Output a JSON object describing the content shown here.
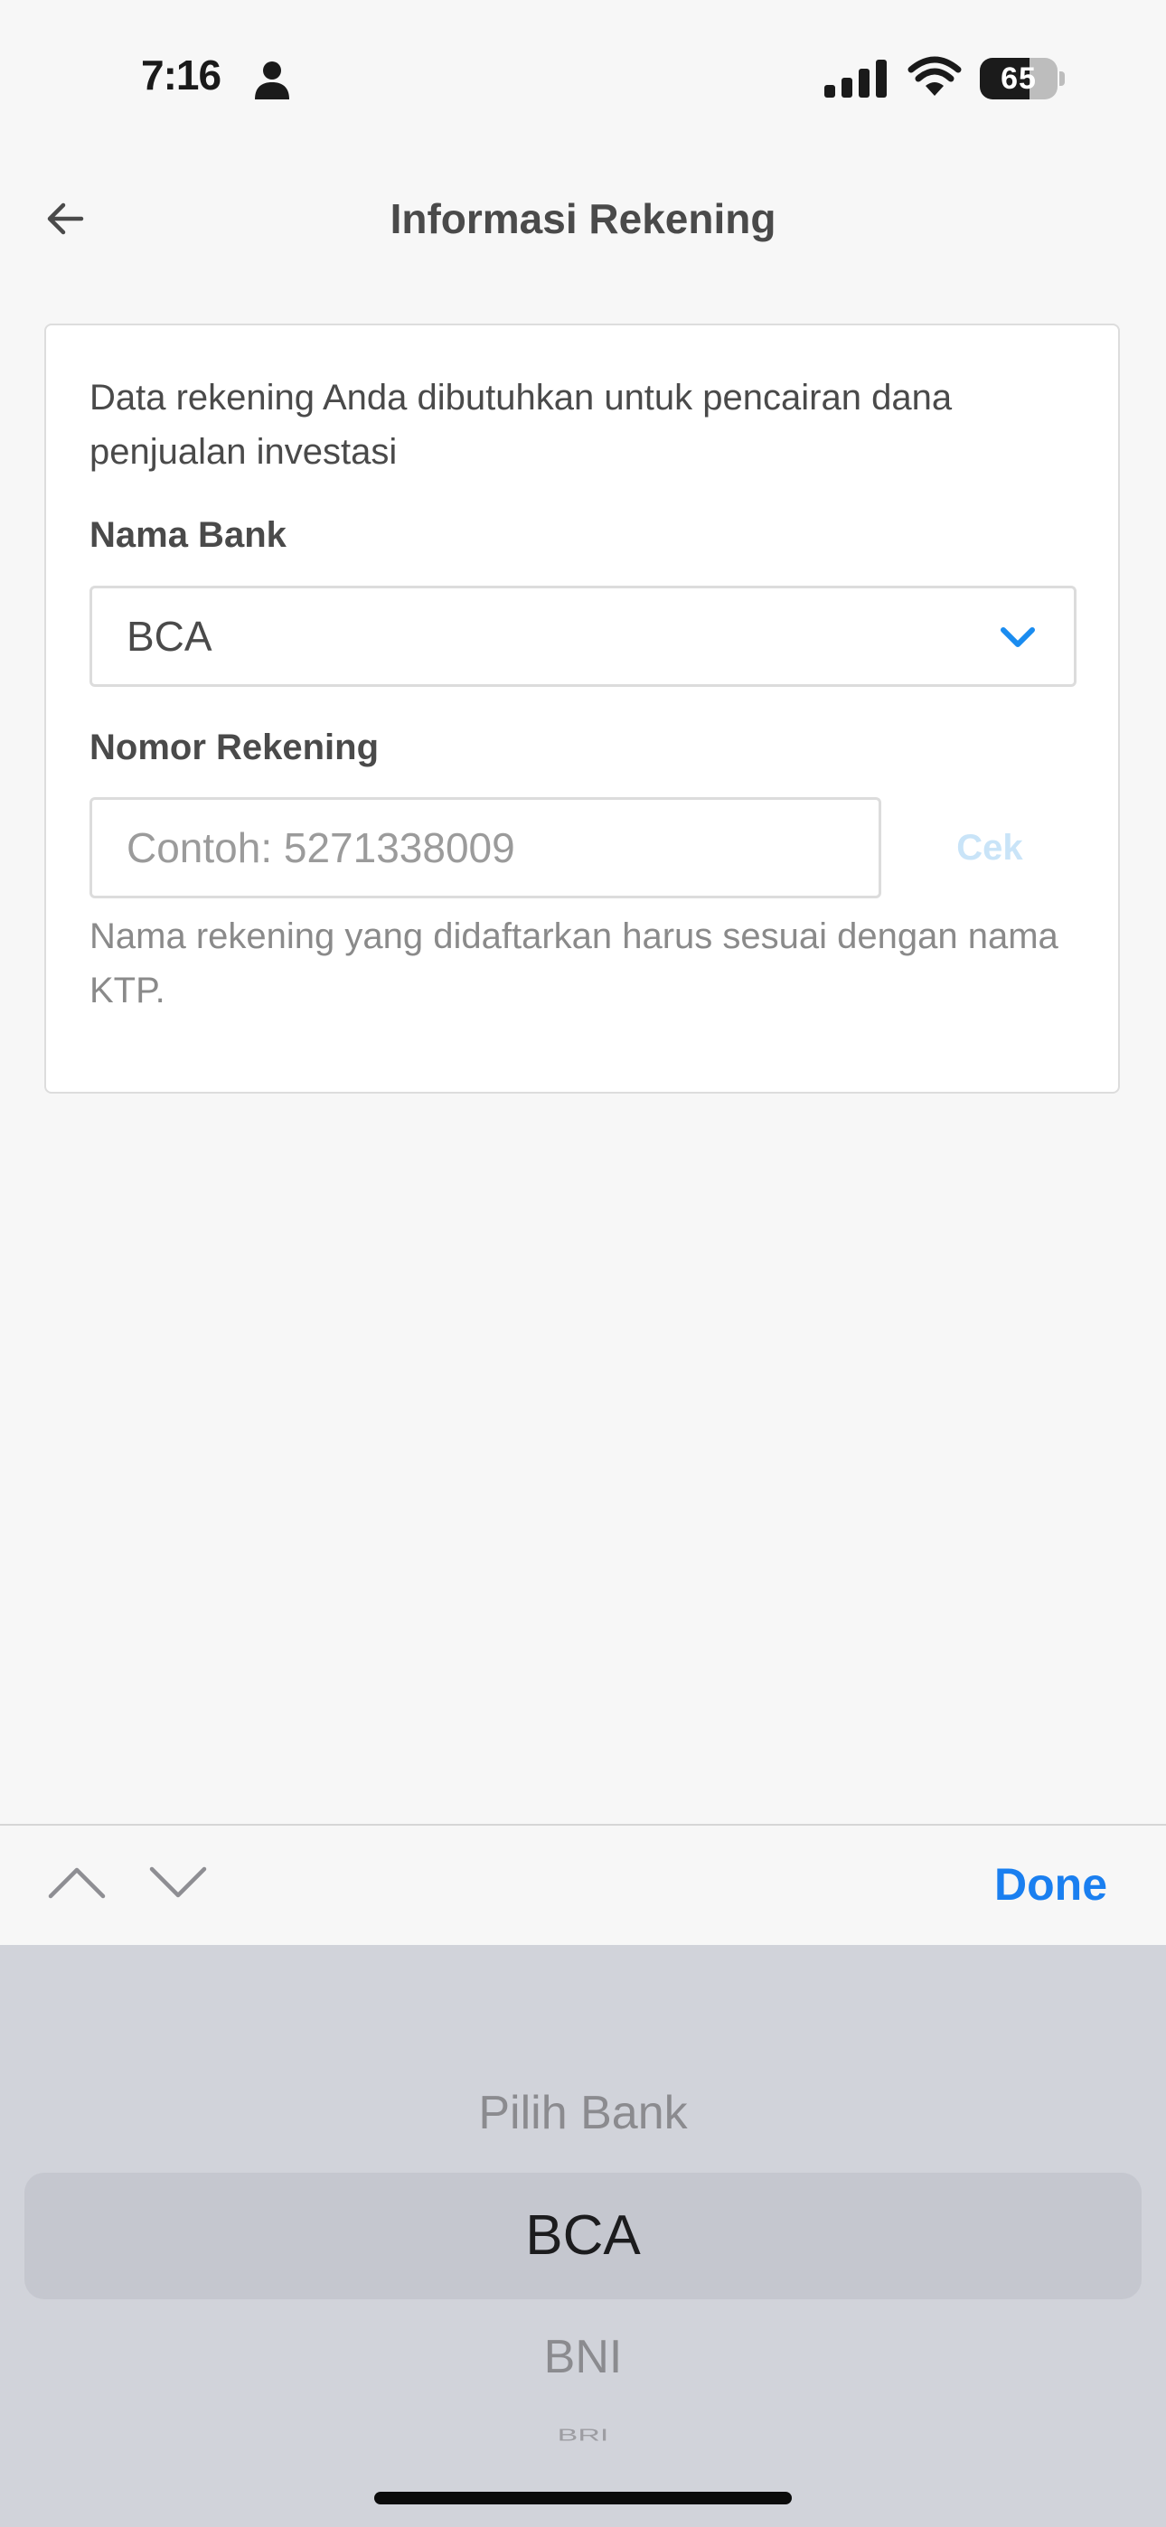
{
  "status_bar": {
    "time": "7:16",
    "battery": "65"
  },
  "header": {
    "title": "Informasi Rekening"
  },
  "form": {
    "description": "Data rekening Anda dibutuhkan untuk pencairan dana penjualan investasi",
    "bank_label": "Nama Bank",
    "bank_value": "BCA",
    "account_label": "Nomor Rekening",
    "account_placeholder": "Contoh: 5271338009",
    "account_value": "",
    "check_label": "Cek",
    "hint": "Nama rekening yang didaftarkan harus sesuai dengan nama KTP."
  },
  "keyboard_toolbar": {
    "done_label": "Done"
  },
  "picker": {
    "options": [
      "Pilih Bank",
      "BCA",
      "BNI",
      "BRI"
    ],
    "selected": "BCA"
  },
  "colors": {
    "accent": "#1a7ff0",
    "chevron": "#1a8cf0",
    "check_disabled": "#c9e4f8",
    "background": "#f7f7f7",
    "picker_background": "#d1d3da"
  },
  "icons": {
    "back": "arrow-left-icon",
    "select": "chevron-down-icon",
    "prev": "chevron-up-icon",
    "next": "chevron-down-icon"
  }
}
